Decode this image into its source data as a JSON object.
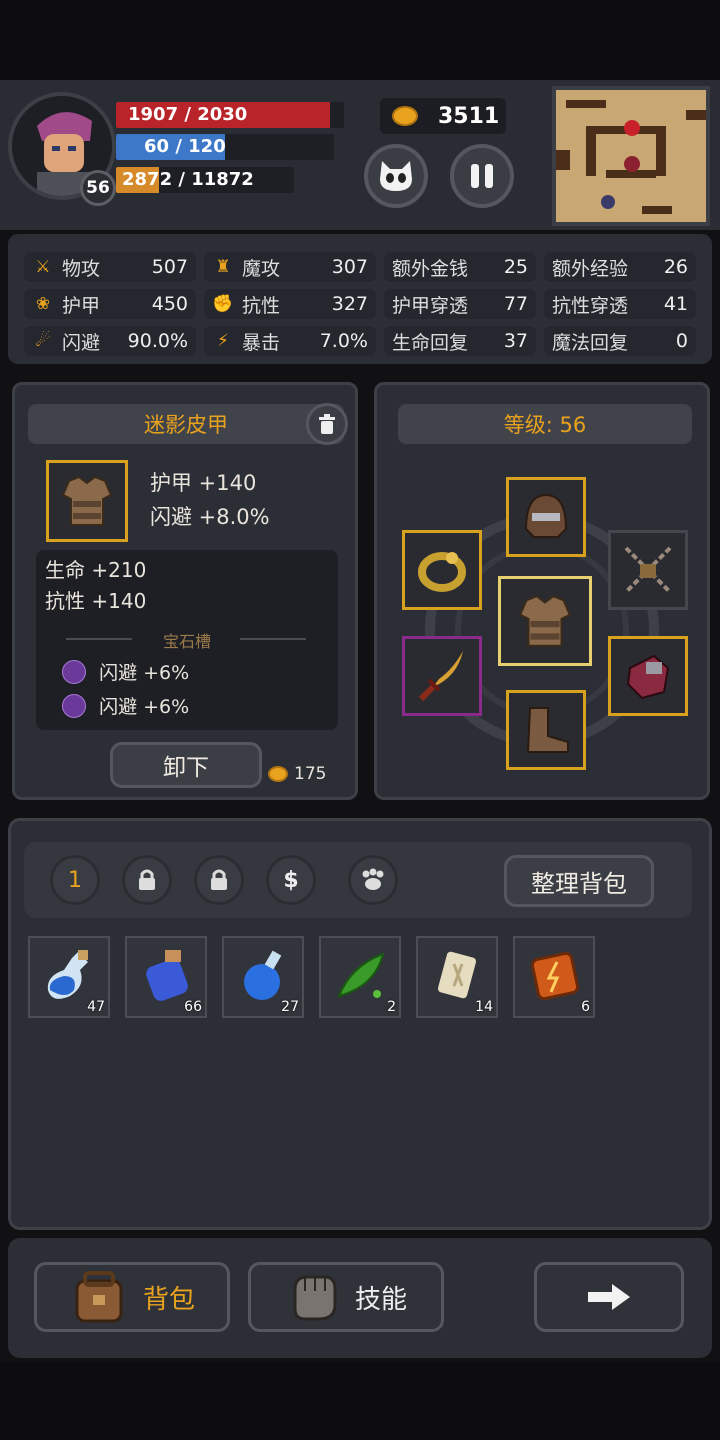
{
  "player": {
    "level": "56",
    "hp_text": "1907 / 2030",
    "hp_fraction": 0.939,
    "mp_text": "60 / 120",
    "mp_fraction": 0.5,
    "xp_text": "2872 / 11872",
    "xp_fraction": 0.242,
    "gold": "3511"
  },
  "stats": [
    {
      "icon": "sword-icon",
      "label": "物攻",
      "value": "507"
    },
    {
      "icon": "magic-hat-icon",
      "label": "魔攻",
      "value": "307"
    },
    {
      "icon": "",
      "label": "额外金钱",
      "value": "25"
    },
    {
      "icon": "",
      "label": "额外经验",
      "value": "26"
    },
    {
      "icon": "paw-icon",
      "label": "护甲",
      "value": "450"
    },
    {
      "icon": "muscle-icon",
      "label": "抗性",
      "value": "327"
    },
    {
      "icon": "",
      "label": "护甲穿透",
      "value": "77"
    },
    {
      "icon": "",
      "label": "抗性穿透",
      "value": "41"
    },
    {
      "icon": "runner-icon",
      "label": "闪避",
      "value": "90.0%"
    },
    {
      "icon": "lightning-icon",
      "label": "暴击",
      "value": "7.0%"
    },
    {
      "icon": "",
      "label": "生命回复",
      "value": "37"
    },
    {
      "icon": "",
      "label": "魔法回复",
      "value": "0"
    }
  ],
  "item": {
    "name": "迷影皮甲",
    "main_stats": [
      "护甲 +140",
      "闪避 +8.0%"
    ],
    "bonus_stats": [
      "生命 +210",
      "抗性 +140"
    ],
    "gem_header": "宝石槽",
    "gems": [
      "闪避 +6%",
      "闪避 +6%"
    ],
    "unequip_label": "卸下",
    "sell_price": "175"
  },
  "equipment": {
    "level_label": "等级: 56"
  },
  "bag": {
    "tab_1": "1",
    "sort_label": "整理背包",
    "items": [
      {
        "icon": "small-blue-potion-icon",
        "count": "47"
      },
      {
        "icon": "blue-jar-potion-icon",
        "count": "66"
      },
      {
        "icon": "round-blue-flask-icon",
        "count": "27"
      },
      {
        "icon": "pea-pod-icon",
        "count": "2"
      },
      {
        "icon": "rune-stone-icon",
        "count": "14"
      },
      {
        "icon": "fire-rune-icon",
        "count": "6"
      }
    ]
  },
  "footer": {
    "bag_label": "背包",
    "skills_label": "技能"
  },
  "colors": {
    "accent_gold": "#e8a21e",
    "hp_red": "#b8242a",
    "mp_blue": "#3d78c8",
    "xp_orange": "#d78a2a",
    "panel": "#2c2e36"
  }
}
